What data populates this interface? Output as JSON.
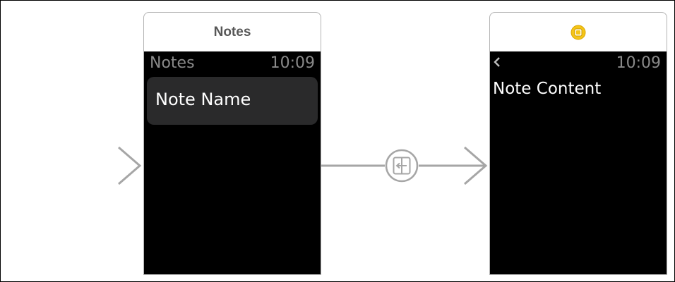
{
  "storyboard": {
    "initial_arrow": {
      "icon": "initial-entry-arrow-icon"
    },
    "segue": {
      "icon": "push-segue-icon"
    }
  },
  "notes_scene": {
    "title": "Notes",
    "status": {
      "title": "Notes",
      "time": "10:09"
    },
    "table_row": {
      "label": "Note Name"
    }
  },
  "detail_scene": {
    "header_icon": "interface-controller-icon",
    "status": {
      "back_icon": "chevron-left-icon",
      "time": "10:09"
    },
    "content_label": "Note Content"
  },
  "colors": {
    "screen_background": "#000000",
    "row_background": "#2a2a2b",
    "status_text": "#8a8a8a",
    "header_title": "#575757",
    "controller_icon": "#f5c518",
    "connector": "#a6a6a6"
  }
}
